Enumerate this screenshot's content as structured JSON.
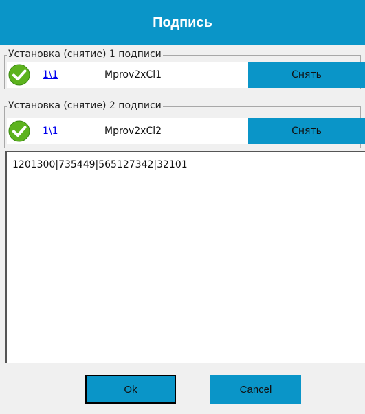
{
  "window": {
    "title": "Подпись"
  },
  "signatures": [
    {
      "legend": "Установка (снятие) 1 подписи",
      "link": "1\\1",
      "cert": "Mprov2xCl1",
      "action": "Снять"
    },
    {
      "legend": "Установка (снятие) 2 подписи",
      "link": "1\\1",
      "cert": "Mprov2xCl2",
      "action": "Снять"
    }
  ],
  "text_panel": {
    "content": "1201300|735449|565127342|32101"
  },
  "footer": {
    "ok_label": "Ok",
    "cancel_label": "Cancel"
  },
  "colors": {
    "accent": "#0a95c8",
    "check": "#4caf1f"
  },
  "icons": {
    "status": "check-circle-icon"
  }
}
